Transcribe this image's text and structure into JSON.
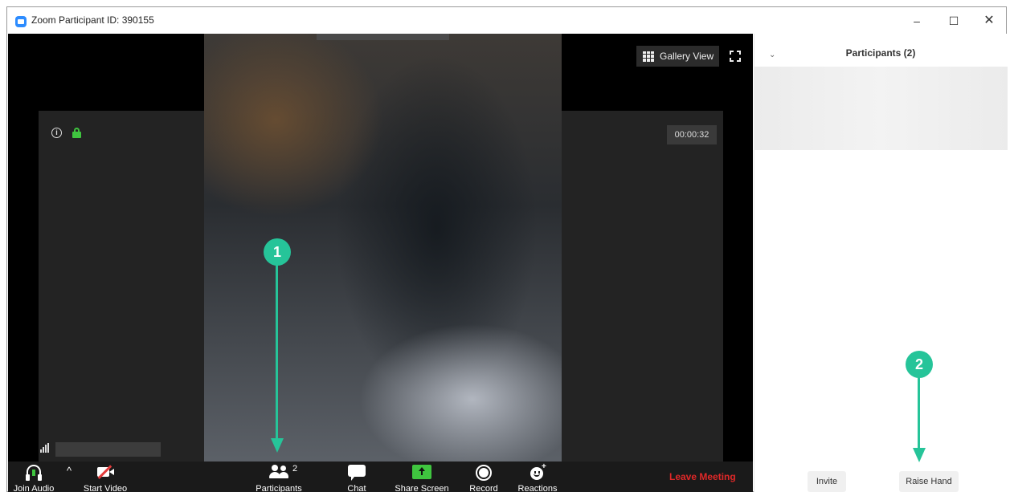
{
  "window": {
    "title": "Zoom Participant ID: 390155",
    "controls": {
      "minimize": "–",
      "maximize": "☐",
      "close": "✕"
    }
  },
  "meeting": {
    "view_button_label": "Gallery View",
    "timer": "00:00:32",
    "participant_count": "2"
  },
  "toolbar": {
    "join_audio": "Join Audio",
    "audio_options_caret": "^",
    "start_video": "Start Video",
    "participants": "Participants",
    "chat": "Chat",
    "share_screen": "Share Screen",
    "record": "Record",
    "reactions": "Reactions",
    "leave_meeting": "Leave Meeting"
  },
  "participants_panel": {
    "collapse_icon": "⌄",
    "title": "Participants (2)",
    "invite_label": "Invite",
    "raise_hand_label": "Raise Hand"
  },
  "annotations": [
    {
      "label": "1"
    },
    {
      "label": "2"
    }
  ],
  "colors": {
    "accent_green": "#26c499",
    "leave_red": "#e02828",
    "secure_green": "#3fc53f",
    "toolbar_bg": "#1a1a1a"
  }
}
